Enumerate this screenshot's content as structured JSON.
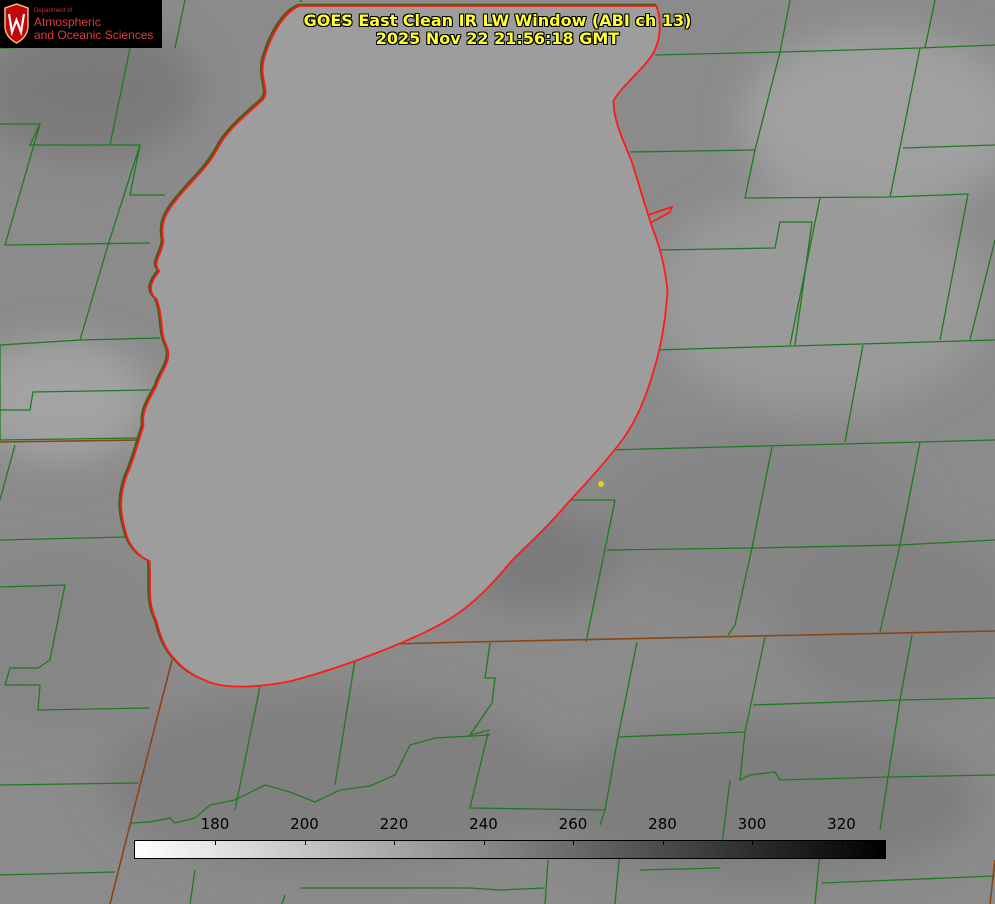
{
  "header": {
    "title_line1": "GOES East Clean IR LW Window (ABI ch 13)",
    "title_line2": "2025 Nov 22 21:56:18 GMT"
  },
  "logo": {
    "line_small": "Department of",
    "line1": "Atmospheric",
    "line2": "and Oceanic Sciences"
  },
  "colorbar": {
    "ticks": [
      "180",
      "200",
      "220",
      "240",
      "260",
      "280",
      "300",
      "320"
    ]
  },
  "colors": {
    "title": "#ffff33",
    "county_lines": "#1f7a1f",
    "state_lines": "#8b4513",
    "coastline": "#ff1a1a",
    "marker": "#e0d020"
  }
}
